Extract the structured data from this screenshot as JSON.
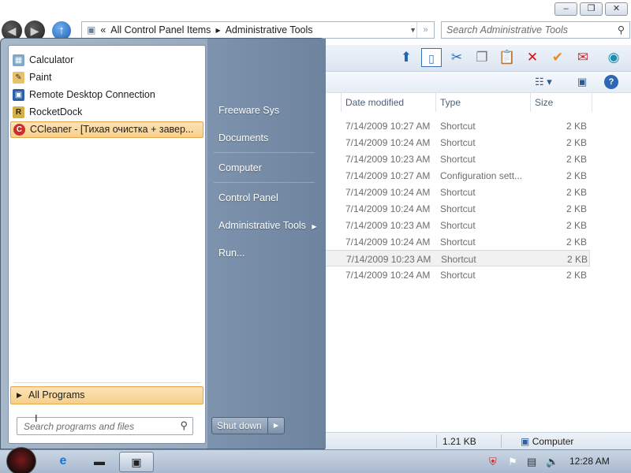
{
  "window": {
    "controls": [
      "–",
      "❐",
      "✕"
    ],
    "address_breadcrumbs": [
      "All Control Panel Items",
      "Administrative Tools"
    ],
    "address_prefix": "«",
    "search_placeholder": "Search Administrative Tools",
    "toolbar_icons": [
      "up-icon",
      "pane-icon",
      "cut-icon",
      "copy-icon",
      "paste-icon",
      "delete-icon",
      "checkmark-icon",
      "mail-icon",
      "globe-icon"
    ],
    "view_icons": [
      "views-icon",
      "preview-pane-icon",
      "help-icon"
    ]
  },
  "columns": [
    "Date modified",
    "Type",
    "Size"
  ],
  "files": [
    {
      "date": "7/14/2009 10:27 AM",
      "type": "Shortcut",
      "size": "2 KB"
    },
    {
      "date": "7/14/2009 10:24 AM",
      "type": "Shortcut",
      "size": "2 KB"
    },
    {
      "date": "7/14/2009 10:23 AM",
      "type": "Shortcut",
      "size": "2 KB"
    },
    {
      "date": "7/14/2009 10:27 AM",
      "type": "Configuration sett...",
      "size": "2 KB"
    },
    {
      "date": "7/14/2009 10:24 AM",
      "type": "Shortcut",
      "size": "2 KB"
    },
    {
      "date": "7/14/2009 10:24 AM",
      "type": "Shortcut",
      "size": "2 KB"
    },
    {
      "date": "7/14/2009 10:23 AM",
      "type": "Shortcut",
      "size": "2 KB"
    },
    {
      "date": "7/14/2009 10:24 AM",
      "type": "Shortcut",
      "size": "2 KB"
    },
    {
      "date": "7/14/2009 10:23 AM",
      "type": "Shortcut",
      "size": "2 KB"
    },
    {
      "date": "7/14/2009 10:24 AM",
      "type": "Shortcut",
      "size": "2 KB"
    }
  ],
  "status": {
    "size": "1.21 KB",
    "location": "Computer"
  },
  "start_menu": {
    "programs": [
      {
        "label": "Calculator",
        "icon": "calculator-icon"
      },
      {
        "label": "Paint",
        "icon": "paint-icon"
      },
      {
        "label": "Remote Desktop Connection",
        "icon": "remote-desktop-icon"
      },
      {
        "label": "RocketDock",
        "icon": "rocketdock-icon"
      },
      {
        "label": "CCleaner - [Тихая очистка + завер...",
        "icon": "ccleaner-icon"
      }
    ],
    "all_programs": "All Programs",
    "search_placeholder": "Search programs and files",
    "right_items": [
      "Freeware Sys",
      "Documents",
      "Computer",
      "Control Panel",
      "Administrative Tools",
      "Run..."
    ],
    "shutdown": "Shut down"
  },
  "taskbar": {
    "clock": "12:28 AM"
  }
}
